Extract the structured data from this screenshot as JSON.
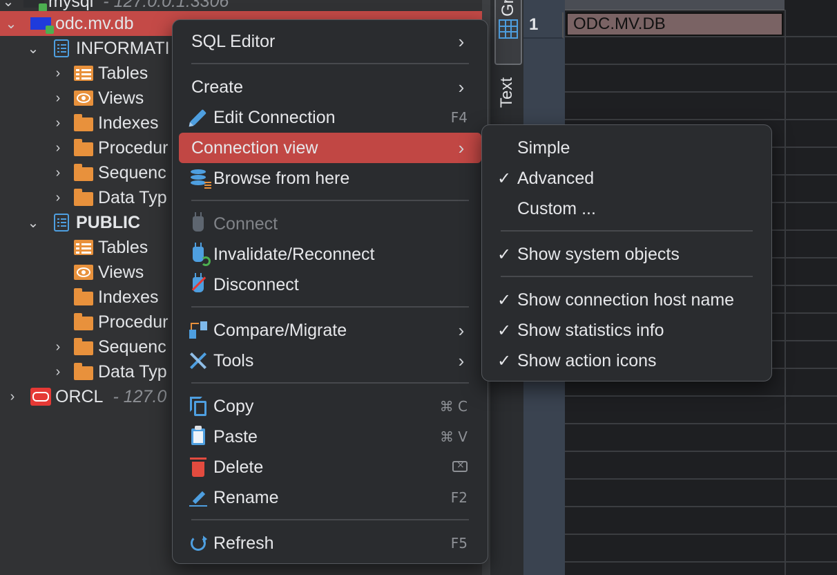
{
  "navigator": {
    "items": [
      {
        "label": "mysql",
        "host": "- 127.0.0.1:3306",
        "icon": "database-icon",
        "expanded": false
      },
      {
        "label": "odc.mv.db",
        "icon": "database-icon",
        "expanded": true,
        "selected": true
      },
      {
        "label": "INFORMATI",
        "icon": "schema-icon",
        "expanded": true
      },
      {
        "label": "Tables",
        "icon": "table-folder-icon"
      },
      {
        "label": "Views",
        "icon": "view-folder-icon"
      },
      {
        "label": "Indexes",
        "icon": "folder-icon"
      },
      {
        "label": "Procedur",
        "icon": "folder-icon"
      },
      {
        "label": "Sequenc",
        "icon": "folder-icon"
      },
      {
        "label": "Data Typ",
        "icon": "folder-icon"
      },
      {
        "label": "PUBLIC",
        "icon": "schema-icon",
        "expanded": true
      },
      {
        "label": "Tables",
        "icon": "table-folder-icon"
      },
      {
        "label": "Views",
        "icon": "view-folder-icon"
      },
      {
        "label": "Indexes",
        "icon": "folder-icon"
      },
      {
        "label": "Procedur",
        "icon": "folder-icon"
      },
      {
        "label": "Sequenc",
        "icon": "folder-icon"
      },
      {
        "label": "Data Typ",
        "icon": "folder-icon"
      },
      {
        "label": "ORCL",
        "host": "- 127.0",
        "icon": "oracle-icon",
        "expanded": false
      }
    ]
  },
  "results": {
    "tabs": {
      "grid": "Gri",
      "text": "Text"
    },
    "row_numbers": [
      "1"
    ],
    "cell_value": "ODC.MV.DB"
  },
  "context_menu": {
    "sql_editor": "SQL Editor",
    "create": "Create",
    "edit_connection": "Edit Connection",
    "edit_connection_shortcut": "F4",
    "connection_view": "Connection view",
    "browse_from_here": "Browse from here",
    "connect": "Connect",
    "invalidate_reconnect": "Invalidate/Reconnect",
    "disconnect": "Disconnect",
    "compare_migrate": "Compare/Migrate",
    "tools": "Tools",
    "copy": "Copy",
    "copy_shortcut": "⌘ C",
    "paste": "Paste",
    "paste_shortcut": "⌘ V",
    "delete": "Delete",
    "rename": "Rename",
    "rename_shortcut": "F2",
    "refresh": "Refresh",
    "refresh_shortcut": "F5"
  },
  "submenu": {
    "simple": "Simple",
    "advanced": "Advanced",
    "custom": "Custom ...",
    "show_system_objects": "Show system objects",
    "show_connection_host_name": "Show connection host name",
    "show_statistics_info": "Show statistics info",
    "show_action_icons": "Show action icons",
    "check_mark": "✓"
  },
  "colors": {
    "selection": "#c44a47",
    "menu_highlight": "#c14744",
    "accent_blue": "#4e9fe0",
    "folder_orange": "#e8913c"
  }
}
